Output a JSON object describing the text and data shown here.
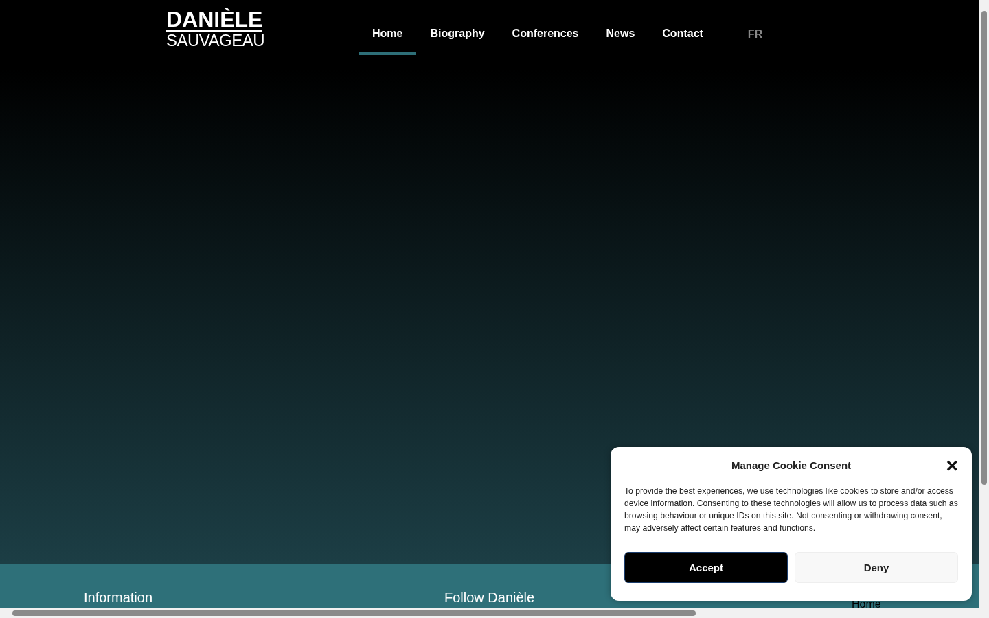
{
  "header": {
    "logo": {
      "line_1": "DANIÈLE",
      "line_2": "SAUVAGEAU"
    },
    "nav": [
      {
        "label": "Home",
        "selected": true
      },
      {
        "label": "Biography",
        "selected": false
      },
      {
        "label": "Conferences",
        "selected": false
      },
      {
        "label": "News",
        "selected": false
      },
      {
        "label": "Contact",
        "selected": false
      }
    ],
    "language": "FR"
  },
  "footer": {
    "headings": [
      "Information",
      "Follow Danièle"
    ],
    "link": "Home"
  },
  "cookie_dialog": {
    "title": "Manage Cookie Consent",
    "close": "×",
    "text": "To provide the best experiences, we use technologies like cookies to store and/or access device information. Consenting to these technologies will allow us to process data such as browsing behaviour or unique IDs on this site. Not consenting or withdrawing consent, may adversely affect certain features and functions.",
    "buttons": [
      {
        "label": "Accept",
        "kind": "primary"
      },
      {
        "label": "Deny",
        "kind": "secondary"
      }
    ]
  }
}
